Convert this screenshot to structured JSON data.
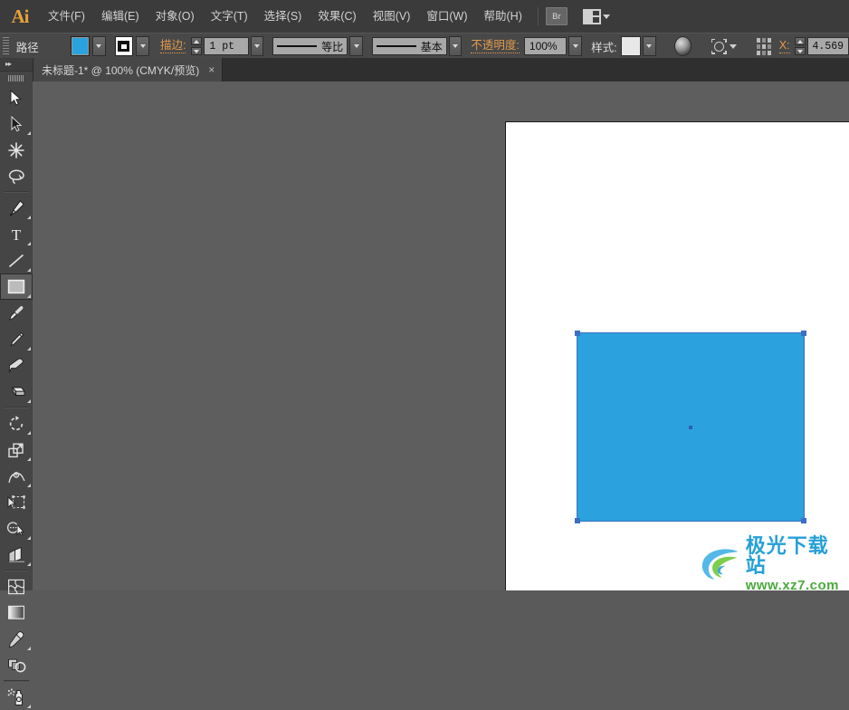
{
  "app": {
    "logo": "Ai",
    "name": "Adobe Illustrator"
  },
  "menubar": {
    "items": [
      {
        "label": "文件(F)",
        "name": "menu-file"
      },
      {
        "label": "编辑(E)",
        "name": "menu-edit"
      },
      {
        "label": "对象(O)",
        "name": "menu-object"
      },
      {
        "label": "文字(T)",
        "name": "menu-type"
      },
      {
        "label": "选择(S)",
        "name": "menu-select"
      },
      {
        "label": "效果(C)",
        "name": "menu-effect"
      },
      {
        "label": "视图(V)",
        "name": "menu-view"
      },
      {
        "label": "窗口(W)",
        "name": "menu-window"
      },
      {
        "label": "帮助(H)",
        "name": "menu-help"
      }
    ],
    "bridge_label": "Br",
    "arrange_icon": "arrange-documents-icon"
  },
  "controlbar": {
    "selection_label": "路径",
    "fill_color": "#2ba2dd",
    "fill_icon": "fill-swatch",
    "stroke_icon": "stroke-swatch",
    "stroke_label": "描边:",
    "stroke_weight": "1 pt",
    "variable_width_profile": "等比",
    "brush_definition": "基本",
    "opacity_label": "不透明度:",
    "opacity_value": "100%",
    "style_label": "样式:",
    "recolor_icon": "recolor-artwork-icon",
    "target_icon": "isolate-selected-object-icon",
    "transform_icon": "transform-reference-point-icon",
    "x_label": "X:",
    "x_value": "4.569"
  },
  "tabbar": {
    "document_tab": "未标题-1* @ 100% (CMYK/预览)",
    "close_glyph": "×"
  },
  "toolbar": {
    "collapse_glyph": "▸▸",
    "groups": [
      {
        "tools": [
          {
            "name": "selection-tool",
            "label": "选择工具",
            "active": false,
            "corner": false
          },
          {
            "name": "direct-selection-tool",
            "label": "直接选择工具",
            "active": false,
            "corner": true
          },
          {
            "name": "magic-wand-tool",
            "label": "魔棒工具",
            "active": false,
            "corner": false
          },
          {
            "name": "lasso-tool",
            "label": "套索工具",
            "active": false,
            "corner": false
          }
        ]
      },
      {
        "tools": [
          {
            "name": "pen-tool",
            "label": "钢笔工具",
            "active": false,
            "corner": true
          },
          {
            "name": "type-tool",
            "label": "文字工具",
            "active": false,
            "corner": true
          },
          {
            "name": "line-segment-tool",
            "label": "直线段工具",
            "active": false,
            "corner": true
          },
          {
            "name": "rectangle-tool",
            "label": "矩形工具",
            "active": true,
            "corner": true
          },
          {
            "name": "paintbrush-tool",
            "label": "画笔工具",
            "active": false,
            "corner": false
          },
          {
            "name": "pencil-tool",
            "label": "铅笔工具",
            "active": false,
            "corner": true
          },
          {
            "name": "blob-brush-tool",
            "label": "斑点画笔工具",
            "active": false,
            "corner": false
          },
          {
            "name": "eraser-tool",
            "label": "橡皮擦工具",
            "active": false,
            "corner": true
          }
        ]
      },
      {
        "tools": [
          {
            "name": "rotate-tool",
            "label": "旋转工具",
            "active": false,
            "corner": true
          },
          {
            "name": "scale-tool",
            "label": "比例缩放工具",
            "active": false,
            "corner": true
          },
          {
            "name": "width-tool",
            "label": "宽度工具",
            "active": false,
            "corner": true
          },
          {
            "name": "free-transform-tool",
            "label": "自由变换工具",
            "active": false,
            "corner": false
          },
          {
            "name": "shape-builder-tool",
            "label": "形状生成器工具",
            "active": false,
            "corner": true
          },
          {
            "name": "perspective-grid-tool",
            "label": "透视网格工具",
            "active": false,
            "corner": true
          }
        ]
      },
      {
        "tools": [
          {
            "name": "mesh-tool",
            "label": "网格工具",
            "active": false,
            "corner": false
          },
          {
            "name": "gradient-tool",
            "label": "渐变工具",
            "active": false,
            "corner": false
          },
          {
            "name": "eyedropper-tool",
            "label": "吸管工具",
            "active": false,
            "corner": true
          },
          {
            "name": "blend-tool",
            "label": "混合工具",
            "active": false,
            "corner": false
          }
        ]
      },
      {
        "tools": [
          {
            "name": "symbol-sprayer-tool",
            "label": "符号喷枪工具",
            "active": false,
            "corner": true
          }
        ]
      }
    ]
  },
  "canvas": {
    "artboard_color": "#ffffff",
    "background_color": "#5e5e5e",
    "shape": {
      "name": "selected-rectangle",
      "fill": "#2ba2dd",
      "selection_color": "#3b6fc4"
    }
  },
  "watermark": {
    "title": "极光下载站",
    "url": "www.xz7.com"
  }
}
